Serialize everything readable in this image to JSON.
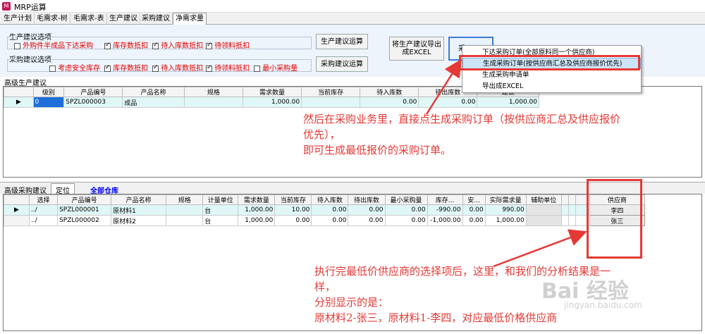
{
  "window": {
    "icon": "mrp-app-icon",
    "title": "MRP运算"
  },
  "tabs": [
    "生产计划",
    "毛需求-树",
    "毛需求-表",
    "生产建议",
    "采购建议",
    "净需求量"
  ],
  "production_options": {
    "title": "生产建议选项",
    "items": [
      {
        "label": "外购件半成品下达采购",
        "checked": false
      },
      {
        "label": "库存数抵扣",
        "checked": true
      },
      {
        "label": "待入库数抵扣",
        "checked": true
      },
      {
        "label": "待领料抵扣",
        "checked": true
      }
    ],
    "button": "生产建议运算"
  },
  "purchase_options": {
    "title": "采购建议选项",
    "items": [
      {
        "label": "考虑安全库存",
        "checked": false
      },
      {
        "label": "库存数抵扣",
        "checked": true
      },
      {
        "label": "待入库数抵扣",
        "checked": true
      },
      {
        "label": "待领料抵扣",
        "checked": true
      },
      {
        "label": "最小采购量",
        "checked": false
      }
    ],
    "button": "采购建议运算"
  },
  "export_button": {
    "line1": "将生产建议导出",
    "line2": "成EXCEL"
  },
  "purchase_button": "采",
  "context_menu": [
    "下达采购订单(全部原料同一个供应商)",
    "生成采购订单(按供应商汇总及供应商报价优先)",
    "生成采购申请单",
    "导出成EXCEL"
  ],
  "production_grid": {
    "title": "高级生产建议",
    "columns": [
      "级别",
      "产品编号",
      "产品名称",
      "规格",
      "需求数量",
      "当前库存",
      "待入库数",
      "待出库数",
      "建议"
    ],
    "rows": [
      {
        "level": "0",
        "code": "SPZL000003",
        "name": "成品",
        "spec": "",
        "demand": "1,000.00",
        "stock": "",
        "incoming": "0.00",
        "outgoing": "0.00",
        "suggest": "1,000.00"
      }
    ]
  },
  "purchase_grid": {
    "title": "高级采购建议",
    "locate": "定位",
    "warehouse": "全部仓库",
    "columns": [
      "选择",
      "产品编号",
      "产品名称",
      "规格",
      "计量单位",
      "需求数量",
      "当前库存",
      "待入库数",
      "待出库数",
      "最小采购量",
      "库存...",
      "安...",
      "实际需求量",
      "辅助单位",
      "",
      "",
      "",
      "供应商"
    ],
    "rows": [
      {
        "select": "../",
        "code": "SPZL000001",
        "name": "原材料1",
        "spec": "",
        "unit": "台",
        "demand": "1,000.00",
        "stock": "10.00",
        "incoming": "0.00",
        "outgoing": "0.00",
        "min": "0.00",
        "inv": "-990.00",
        "safe": "0.00",
        "actual": "990.00",
        "supplier": "李四"
      },
      {
        "select": "../",
        "code": "SPZL000002",
        "name": "原材料2",
        "spec": "",
        "unit": "台",
        "demand": "1,000.00",
        "stock": "0.00",
        "incoming": "0.00",
        "outgoing": "0.00",
        "min": "0.00",
        "inv": "-1,000.00",
        "safe": "0.00",
        "actual": "1,000.00",
        "supplier": "张三"
      }
    ]
  },
  "annotation1": [
    "然后在采购业务里，直接点生成采购订单（按供应商汇总及供应报价",
    "优先），",
    "即可生成最低报价的采购订单。"
  ],
  "annotation2": [
    "执行完最低价供应商的选择项后，这里，和我们的分析结果是一",
    "样，",
    "分别显示的是：",
    "原材料2-张三，原材料1-李四，对应最低价格供应商"
  ],
  "watermark": {
    "main": "Bai 经验",
    "sub": "jingyan.baidu.com"
  },
  "colors": {
    "annotation": "#e53935",
    "selected_row": "#dff7f7",
    "highlight": "#1e6fd9",
    "warehouse_link": "#0000ff"
  }
}
